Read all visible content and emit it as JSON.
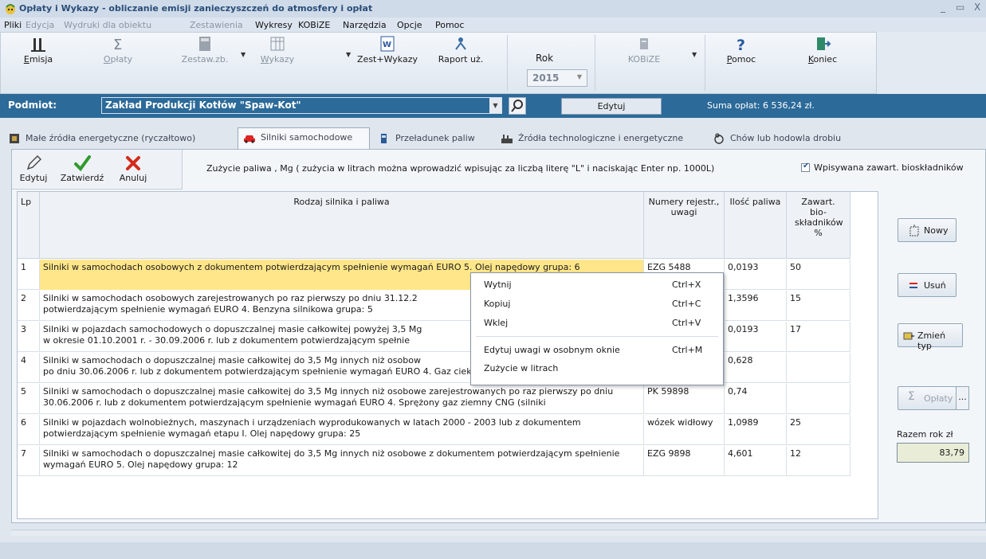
{
  "window": {
    "title": "Opłaty i Wykazy  - obliczanie emisji zanieczyszczeń do atmosfery i opłat",
    "minimize_glyph": "_",
    "maximize_glyph": "▭",
    "close_glyph": "X"
  },
  "menu": {
    "pliki": "Pliki",
    "edycja": "Edycja",
    "wydruki": "Wydruki dla obiektu",
    "zestawienia": "Zestawienia",
    "wykresy": "Wykresy",
    "kobize": "KOBiZE",
    "narzedzia": "Narzędzia",
    "opcje": "Opcje",
    "pomoc": "Pomoc"
  },
  "toolbar": {
    "emisja": {
      "first": "E",
      "rest": "misja"
    },
    "oplaty": {
      "first": "O",
      "rest": "płaty"
    },
    "zestaw": "Zestaw.zb.",
    "wykazy": {
      "first": "W",
      "rest": "ykazy"
    },
    "zest_wykazy": "Zest+Wykazy",
    "raport": "Raport uż.",
    "rok_label": "Rok",
    "rok_value": "2015",
    "kobize": "KOBiZE",
    "pomoc": {
      "first": "P",
      "rest": "omoc"
    },
    "koniec": {
      "first": "K",
      "rest": "oniec"
    }
  },
  "podmiot": {
    "label": "Podmiot:",
    "value": "Zakład Produkcji Kotłów \"Spaw-Kot\"",
    "edit_button": "Edytuj",
    "suma_oplat": "Suma opłat:  6 536,24 zł."
  },
  "tabs": {
    "male_zrodla": "Małe źródła energetyczne (ryczałtowo)",
    "silniki": "Silniki samochodowe",
    "przeladunek": "Przeładunek paliw",
    "zrodla_tech": "Źródła technologiczne i energetyczne",
    "chow": "Chów lub hodowla drobiu"
  },
  "subtoolbar": {
    "edytuj": "Edytuj",
    "zatwierdz": "Zatwierdź",
    "anuluj": "Anuluj",
    "zuzycie_label": "Zużycie paliwa , Mg   ( zużycia w litrach można wprowadzić wpisując za liczbą literę \"L\" i naciskając Enter np. 1000L)",
    "bio_checkbox": "Wpisywana zawart. bioskładników",
    "bio_checked": true
  },
  "grid": {
    "headers": {
      "lp": "Lp",
      "desc": "Rodzaj silnika i paliwa",
      "reg": "Numery rejestr., uwagi",
      "ilosc": "Ilość paliwa",
      "bio": "Zawart. bio- składników %"
    },
    "rows": [
      {
        "lp": "1",
        "desc": "Silniki w samochodach osobowych z dokumentem potwierdzającym spełnienie wymagań EURO 5. Olej napędowy  grupa: 6",
        "reg": "EZG 5488",
        "ilosc": "0,0193",
        "bio": "50"
      },
      {
        "lp": "2",
        "desc": "Silniki w samochodach osobowych zarejestrowanych po raz pierwszy po dniu 31.12.2\n potwierdzającym spełnienie wymagań EURO 4. Benzyna silnikowa  grupa: 5",
        "reg": "",
        "ilosc": "1,3596",
        "bio": "15"
      },
      {
        "lp": "3",
        "desc": "Silniki w pojazdach samochodowych o dopuszczalnej masie całkowitej powyżej 3,5 Mg\n w okresie 01.10.2001 r. - 30.09.2006 r. lub z dokumentem potwierdzającym spełnie",
        "reg": "",
        "ilosc": "0,0193",
        "bio": "17"
      },
      {
        "lp": "4",
        "desc": "Silniki w samochodach o dopuszczalnej masie całkowitej do 3,5 Mg innych niż osobow\n po dniu 30.06.2006 r. lub z dokumentem potwierdzającym spełnienie wymagań EURO 4. Gaz ciekły propan-butan  grupa:",
        "reg": "",
        "ilosc": "0,628",
        "bio": ""
      },
      {
        "lp": "5",
        "desc": "Silniki w samochodach o dopuszczalnej masie całkowitej do 3,5 Mg innych niż osobowe zarejestrowanych po raz pierwszy po dniu 30.06.2006 r. lub z dokumentem potwierdzającym spełnienie wymagań EURO 4. Sprężony gaz ziemny CNG (silniki",
        "reg": "PK 59898",
        "ilosc": "0,74",
        "bio": ""
      },
      {
        "lp": "6",
        "desc": "Silniki w pojazdach wolnobieżnych, maszynach i urządzeniach wyprodukowanych w latach 2000 - 2003 lub z dokumentem potwierdzającym spełnienie wymagań etapu I. Olej napędowy  grupa: 25",
        "reg": "wózek widłowy",
        "ilosc": "1,0989",
        "bio": "25"
      },
      {
        "lp": "7",
        "desc": "Silniki w samochodach o dopuszczalnej masie całkowitej do 3,5 Mg innych niż osobowe z dokumentem potwierdzającym spełnienie wymagań EURO 5. Olej napędowy  grupa: 12",
        "reg": "EZG 9898",
        "ilosc": "4,601",
        "bio": "12"
      }
    ]
  },
  "context_menu": {
    "wytnij": "Wytnij",
    "wytnij_key": "Ctrl+X",
    "kopiuj": "Kopiuj",
    "kopiuj_key": "Ctrl+C",
    "wklej": "Wklej",
    "wklej_key": "Ctrl+V",
    "edytuj_uwagi": "Edytuj uwagi w osobnym oknie",
    "edytuj_uwagi_key": "Ctrl+M",
    "zuzycie_litrach": "Zużycie w litrach"
  },
  "side": {
    "nowy": "Nowy",
    "usun": "Usuń",
    "zmien_typ": "Zmień typ",
    "oplaty": "Opłaty",
    "more": "...",
    "razem_label": "Razem rok zł",
    "razem_value": "83,79"
  },
  "colors": {
    "podmiot_bar": "#2c6a99",
    "selected_cell": "#ffe68a",
    "accent_check": "#2e9a2e",
    "cancel_red": "#d42a1a"
  }
}
